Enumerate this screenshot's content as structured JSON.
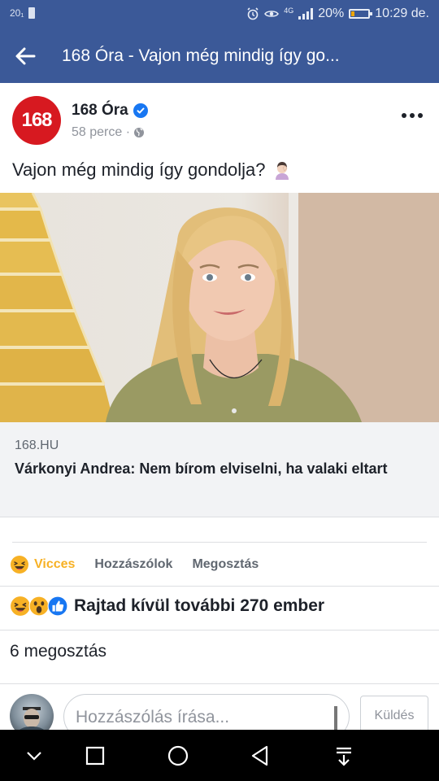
{
  "status_bar": {
    "left_text": "20₁",
    "network": "4G",
    "battery": "20%",
    "battery_level": 0.2,
    "time": "10:29 de."
  },
  "app_bar": {
    "title": "168 Óra - Vajon még mindig így go..."
  },
  "post": {
    "page_avatar_text": "168",
    "page_name": "168 Óra",
    "time": "58 perce ·",
    "caption": "Vajon még mindig így gondolja?",
    "link": {
      "domain": "168.HU",
      "title": "Várkonyi Andrea: Nem bírom elviselni, ha valaki eltart"
    },
    "actions": {
      "react_label": "Vicces",
      "comment_label": "Hozzászólok",
      "share_label": "Megosztás"
    },
    "reactions_summary": "Rajtad kívül további 270 ember",
    "shares_text": "6 megosztás"
  },
  "comment_box": {
    "placeholder": "Hozzászólás írása...",
    "send_label": "Küldés"
  },
  "colors": {
    "brand_blue": "#3b5998",
    "haha_yellow": "#f7b125",
    "like_blue": "#1877f2",
    "avatar_red": "#d71920"
  },
  "icons": [
    "back-arrow-icon",
    "verified-badge-icon",
    "globe-icon",
    "more-icon",
    "facepalm-emoji-icon",
    "haha-reaction-icon",
    "wow-reaction-icon",
    "like-reaction-icon",
    "nav-chevron-down-icon",
    "nav-recents-icon",
    "nav-home-icon",
    "nav-back-icon",
    "nav-notification-icon"
  ]
}
